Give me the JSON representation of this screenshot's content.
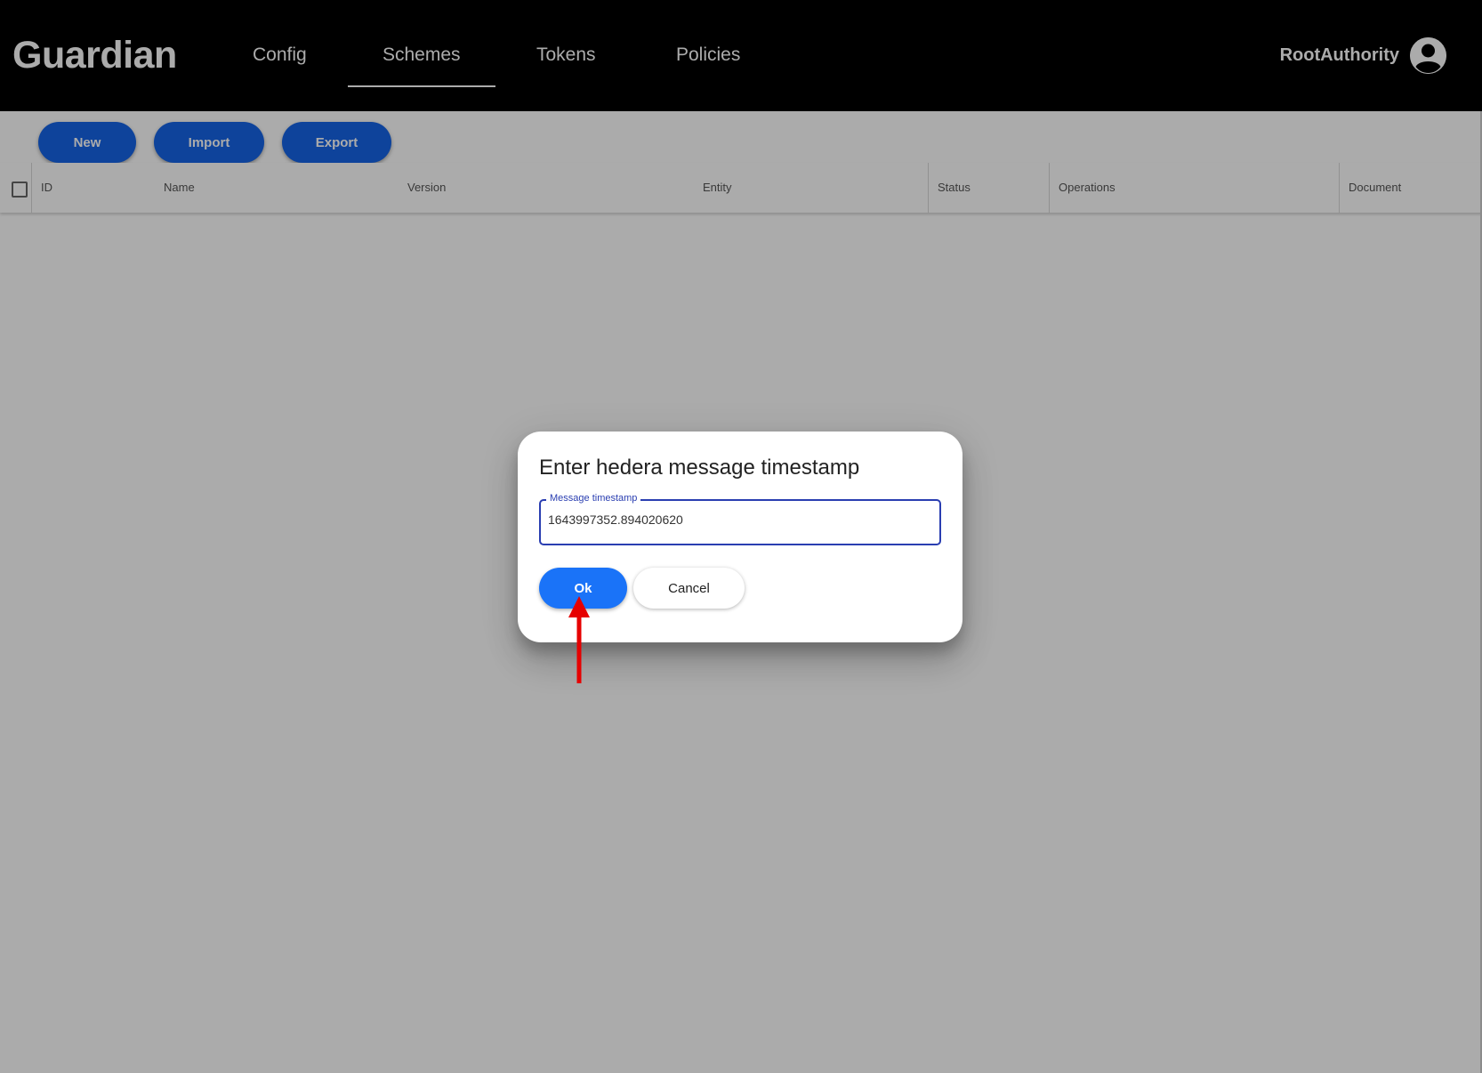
{
  "header": {
    "logo": "Guardian",
    "nav": [
      {
        "label": "Config",
        "active": false
      },
      {
        "label": "Schemes",
        "active": true
      },
      {
        "label": "Tokens",
        "active": false
      },
      {
        "label": "Policies",
        "active": false
      }
    ],
    "user": {
      "name": "RootAuthority",
      "avatar_icon": "account-circle-icon"
    }
  },
  "toolbar": {
    "new_label": "New",
    "import_label": "Import",
    "export_label": "Export"
  },
  "table": {
    "columns": [
      "ID",
      "Name",
      "Version",
      "Entity",
      "Status",
      "Operations",
      "Document"
    ],
    "rows": []
  },
  "dialog": {
    "title": "Enter hedera message timestamp",
    "field": {
      "label": "Message timestamp",
      "value": "1643997352.894020620"
    },
    "ok_label": "Ok",
    "cancel_label": "Cancel"
  },
  "annotation": {
    "icon": "red-arrow-up-icon",
    "color": "#e60000"
  },
  "colors": {
    "header_bg": "#000000",
    "primary_button": "#1565e8",
    "ok_button": "#1a73f8",
    "field_accent": "#2a3eb1"
  }
}
